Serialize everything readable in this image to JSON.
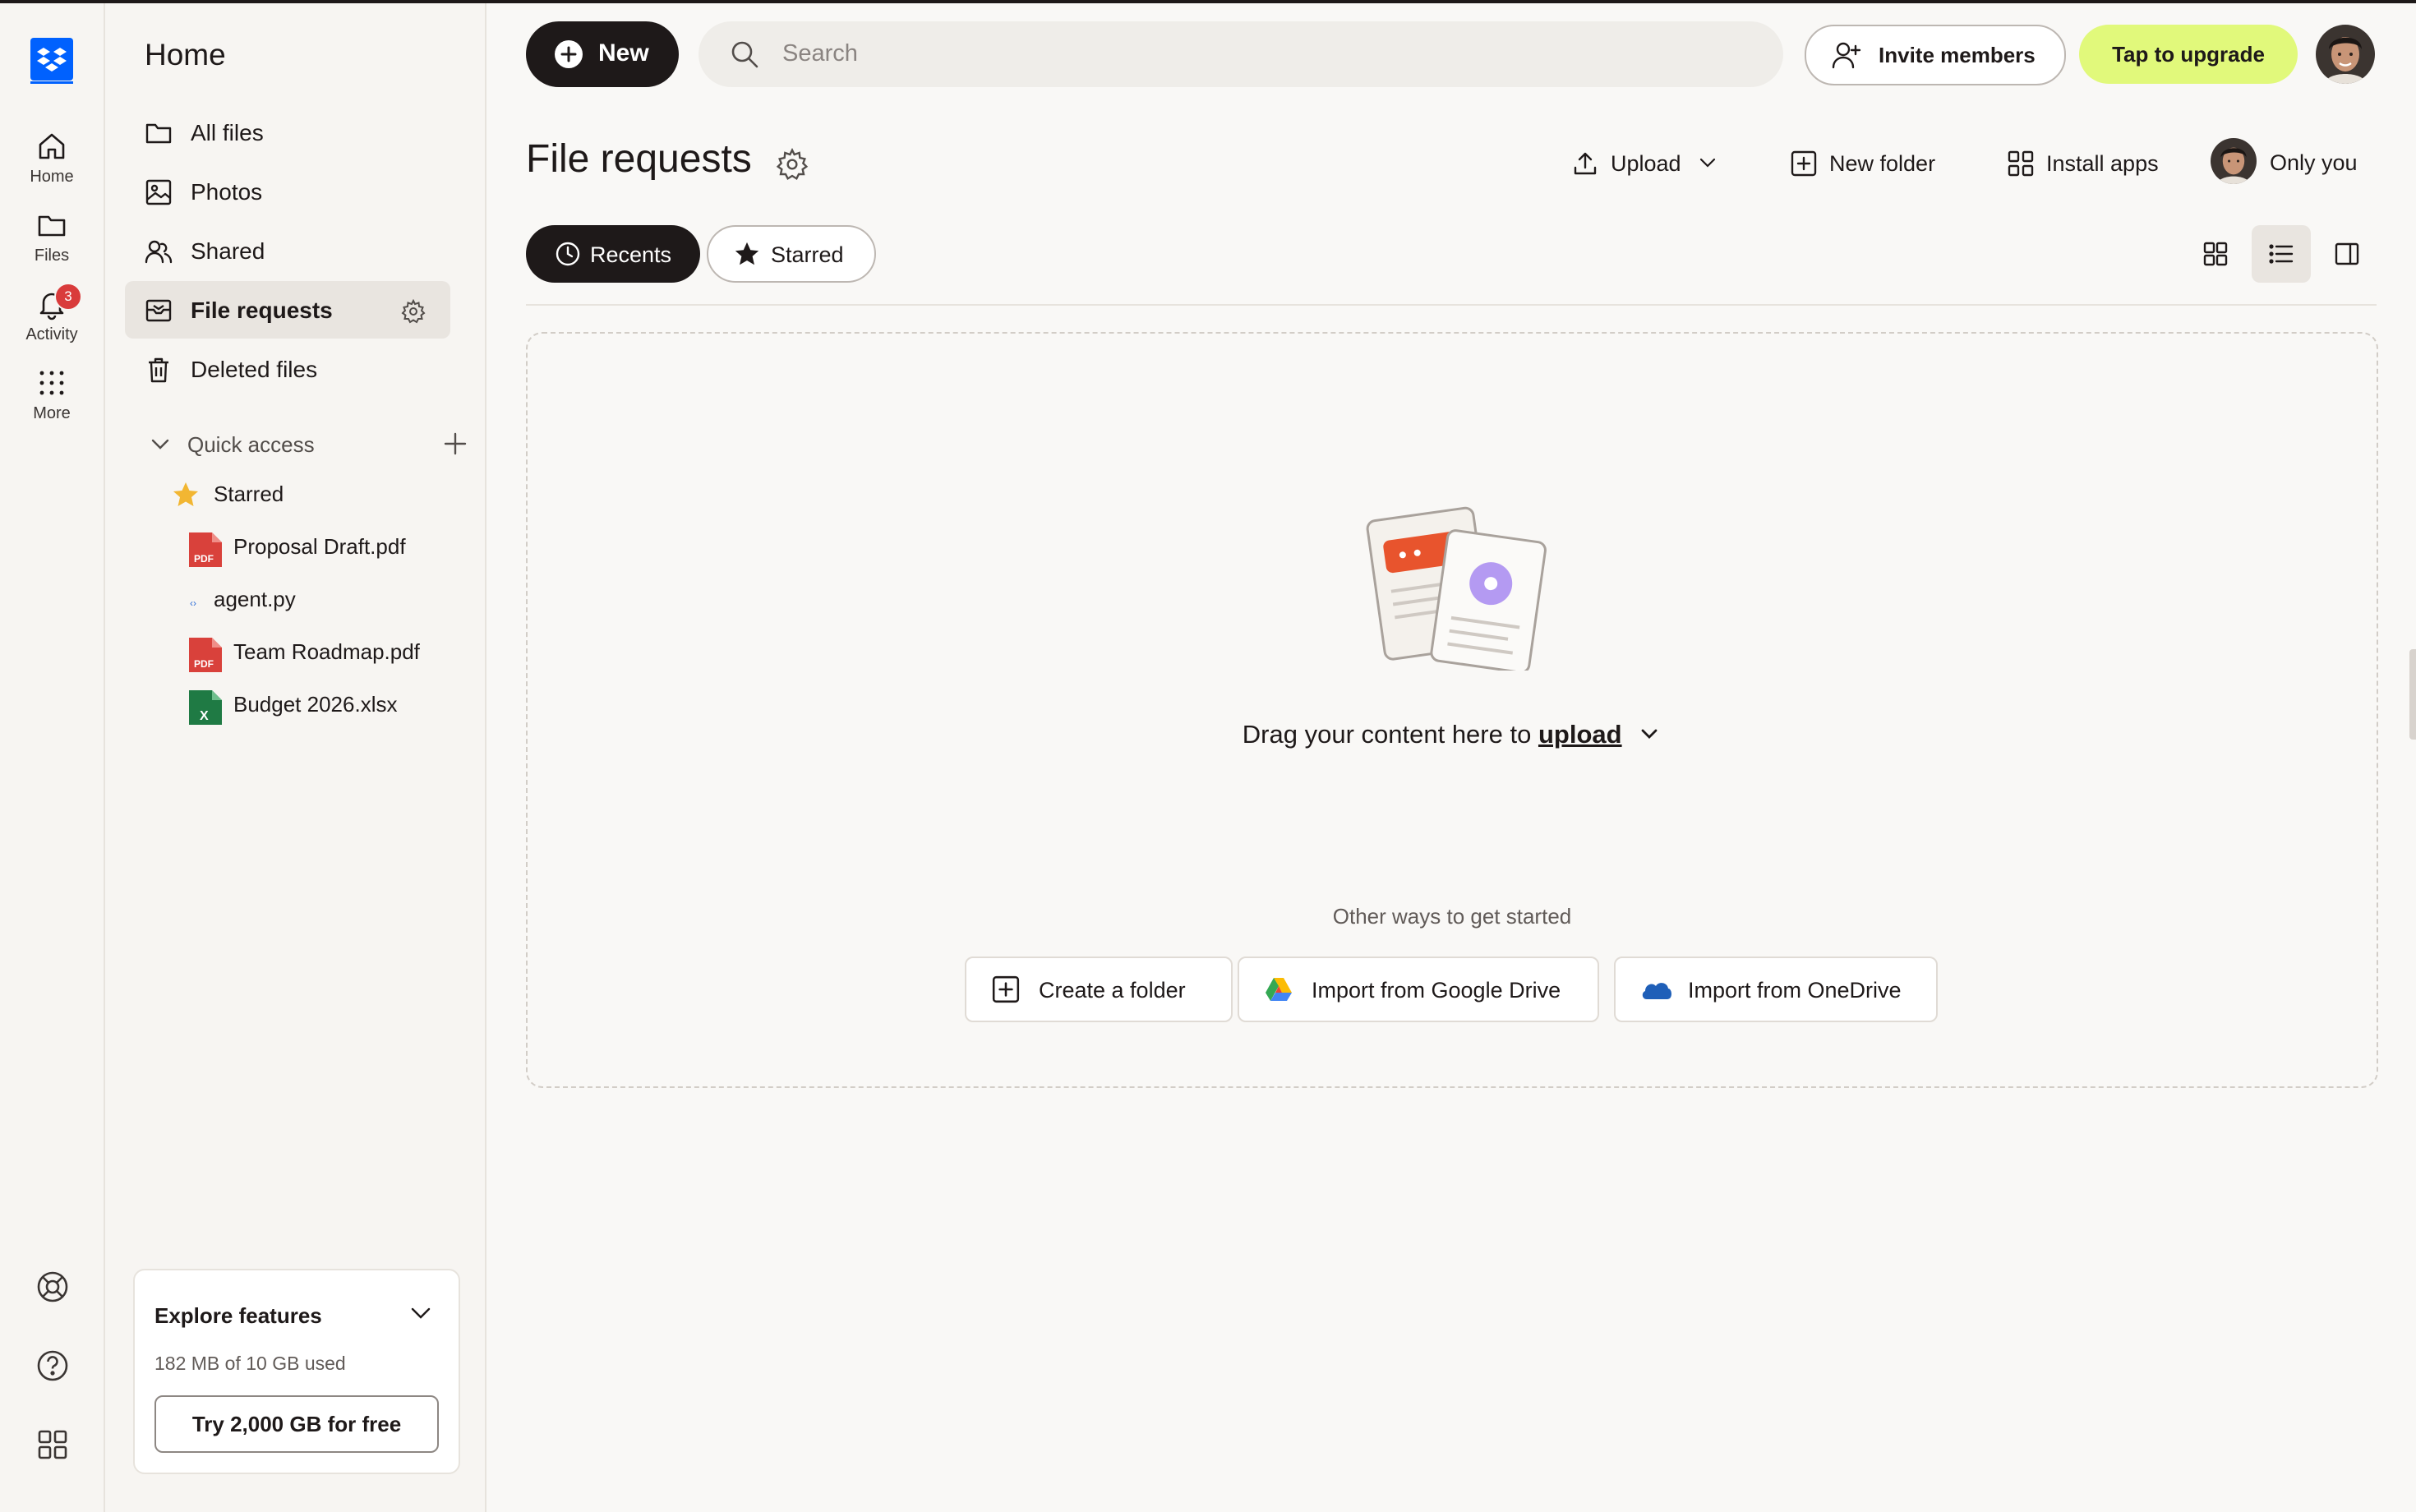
{
  "rail": {
    "items": [
      {
        "label": "Home",
        "icon": "home-icon"
      },
      {
        "label": "Files",
        "icon": "folder-icon"
      },
      {
        "label": "Activity",
        "icon": "bell-icon",
        "badge": "3"
      },
      {
        "label": "More",
        "icon": "grid-dots-icon"
      }
    ],
    "bottom_icons": [
      "support-icon",
      "help-icon",
      "apps-icon"
    ]
  },
  "sidebar": {
    "title": "Home",
    "nav": [
      {
        "label": "All files",
        "icon": "folder-icon"
      },
      {
        "label": "Photos",
        "icon": "photo-icon"
      },
      {
        "label": "Shared",
        "icon": "shared-icon"
      },
      {
        "label": "File requests",
        "icon": "file-request-icon",
        "active": true
      },
      {
        "label": "Deleted files",
        "icon": "trash-icon"
      }
    ],
    "quick_access": {
      "label": "Quick access",
      "items": [
        {
          "label": "Starred",
          "icon": "star-icon"
        },
        {
          "label": "Proposal Draft.pdf",
          "icon": "pdf-icon",
          "icon_text": "PDF"
        },
        {
          "label": "agent.py",
          "icon": "python-file-icon",
          "icon_text": "‹›"
        },
        {
          "label": "Team Roadmap.pdf",
          "icon": "pdf-icon",
          "icon_text": "PDF"
        },
        {
          "label": "Budget 2026.xlsx",
          "icon": "excel-icon",
          "icon_text": "X"
        }
      ]
    },
    "explore": {
      "title": "Explore features",
      "usage": "182 MB of 10 GB used",
      "cta": "Try 2,000 GB for free"
    }
  },
  "topbar": {
    "new_label": "New",
    "search_placeholder": "Search",
    "invite_label": "Invite members",
    "upgrade_label": "Tap to upgrade"
  },
  "page": {
    "title": "File requests",
    "actions": {
      "upload": "Upload",
      "new_folder": "New folder",
      "install_apps": "Install apps",
      "sharing": "Only you"
    },
    "tabs": [
      {
        "label": "Recents",
        "active": true
      },
      {
        "label": "Starred",
        "active": false
      }
    ],
    "view_modes": [
      "grid-view-icon",
      "list-view-icon",
      "side-panel-icon"
    ],
    "active_view": "list"
  },
  "dropzone": {
    "text": "Drag your content here to",
    "link": "upload",
    "other_label": "Other ways to get started",
    "options": [
      {
        "label": "Create a folder",
        "icon": "plus-square-icon"
      },
      {
        "label": "Import from Google Drive",
        "icon": "google-drive-icon"
      },
      {
        "label": "Import from OneDrive",
        "icon": "onedrive-icon"
      }
    ]
  },
  "colors": {
    "accent_dark": "#1e1919",
    "upgrade": "#e1f97b",
    "dropbox_blue": "#0061fe",
    "badge": "#d93b3b",
    "pdf_red": "#d9413b",
    "excel_green": "#1f7a44",
    "star": "#f2b632"
  }
}
